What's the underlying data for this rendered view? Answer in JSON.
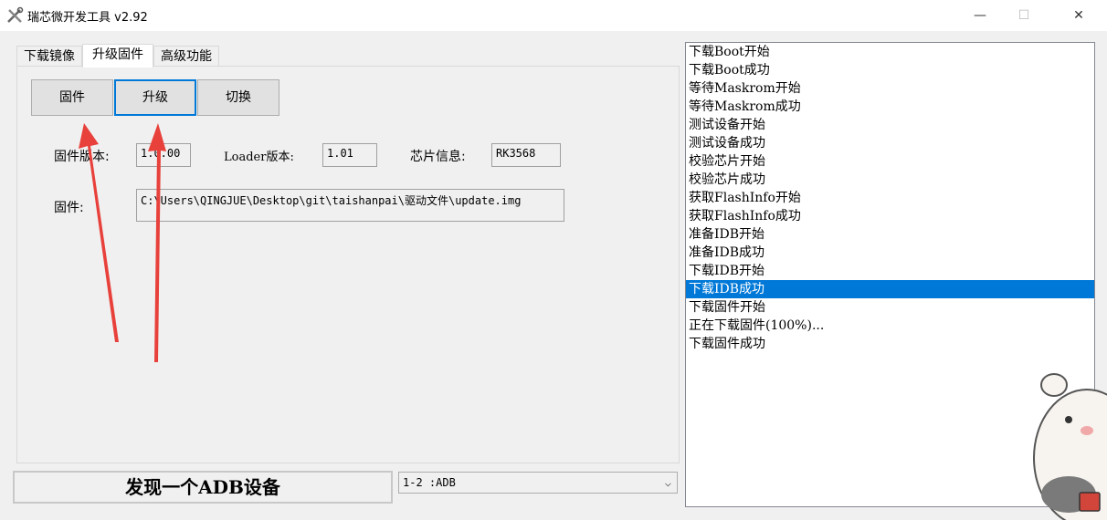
{
  "window": {
    "title": "瑞芯微开发工具 v2.92",
    "minimize": "—",
    "maximize": "☐",
    "close": "✕"
  },
  "tabs": [
    {
      "label": "下载镜像",
      "active": false
    },
    {
      "label": "升级固件",
      "active": true
    },
    {
      "label": "高级功能",
      "active": false
    }
  ],
  "buttons": {
    "firmware": "固件",
    "upgrade": "升级",
    "switch": "切换"
  },
  "info": {
    "firmware_version_label": "固件版本:",
    "firmware_version_value": "1.0.00",
    "loader_version_label": "Loader版本:",
    "loader_version_value": "1.01",
    "chip_label": "芯片信息:",
    "chip_value": "RK3568",
    "firmware_path_label": "固件:",
    "firmware_path_value": "C:\\Users\\QINGJUE\\Desktop\\git\\taishanpai\\驱动文件\\update.img"
  },
  "status": {
    "message": "发现一个ADB设备",
    "device_select": "1-2 :ADB"
  },
  "log": [
    {
      "text": "下载Boot开始",
      "selected": false
    },
    {
      "text": "下载Boot成功",
      "selected": false
    },
    {
      "text": "等待Maskrom开始",
      "selected": false
    },
    {
      "text": "等待Maskrom成功",
      "selected": false
    },
    {
      "text": "测试设备开始",
      "selected": false
    },
    {
      "text": "测试设备成功",
      "selected": false
    },
    {
      "text": "校验芯片开始",
      "selected": false
    },
    {
      "text": "校验芯片成功",
      "selected": false
    },
    {
      "text": "获取FlashInfo开始",
      "selected": false
    },
    {
      "text": "获取FlashInfo成功",
      "selected": false
    },
    {
      "text": "准备IDB开始",
      "selected": false
    },
    {
      "text": "准备IDB成功",
      "selected": false
    },
    {
      "text": "下载IDB开始",
      "selected": false
    },
    {
      "text": "下载IDB成功",
      "selected": true
    },
    {
      "text": "下载固件开始",
      "selected": false
    },
    {
      "text": "正在下载固件(100%)...",
      "selected": false
    },
    {
      "text": "下载固件成功",
      "selected": false
    }
  ],
  "colors": {
    "selection": "#0078d7",
    "annotation_arrow": "#e8403a"
  }
}
